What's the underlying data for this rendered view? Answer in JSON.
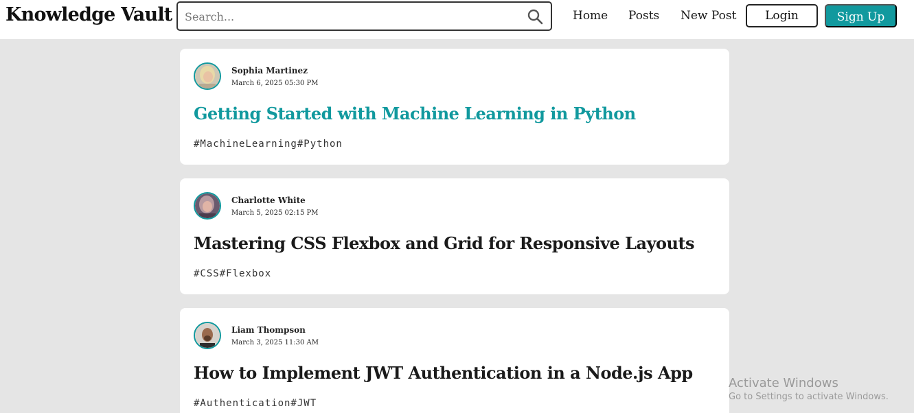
{
  "header": {
    "brand": "Knowledge Vault",
    "search_placeholder": "Search...",
    "nav": [
      "Home",
      "Posts",
      "New Post"
    ],
    "login_label": "Login",
    "signup_label": "Sign Up",
    "accent_color": "#11999e"
  },
  "posts": [
    {
      "author": "Sophia Martinez",
      "date": "March 6, 2025 05:30 PM",
      "title": "Getting Started with Machine Learning in Python",
      "tags": "#MachineLearning#Python",
      "hovered": true
    },
    {
      "author": "Charlotte White",
      "date": "March 5, 2025 02:15 PM",
      "title": "Mastering CSS Flexbox and Grid for Responsive Layouts",
      "tags": "#CSS#Flexbox",
      "hovered": false
    },
    {
      "author": "Liam Thompson",
      "date": "March 3, 2025 11:30 AM",
      "title": "How to Implement JWT Authentication in a Node.js App",
      "tags": "#Authentication#JWT",
      "hovered": false
    }
  ],
  "watermark": {
    "title": "Activate Windows",
    "subtitle": "Go to Settings to activate Windows."
  }
}
